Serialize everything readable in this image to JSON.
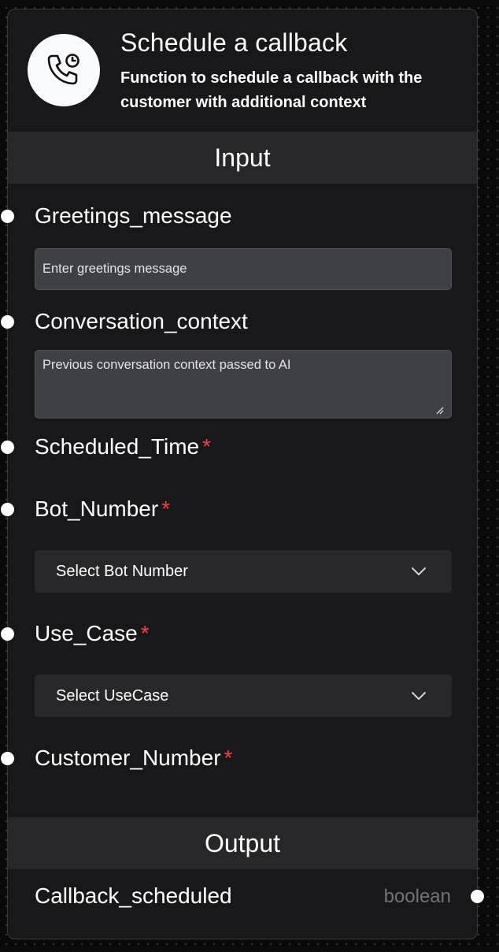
{
  "node": {
    "title": "Schedule a callback",
    "description": "Function to schedule a callback with the customer with additional context",
    "icon": "phone-clock-icon"
  },
  "input_section": {
    "label": "Input",
    "fields": [
      {
        "name": "Greetings_message",
        "required": false,
        "type": "text",
        "placeholder": "Enter greetings message",
        "value": ""
      },
      {
        "name": "Conversation_context",
        "required": false,
        "type": "textarea",
        "placeholder": "Previous conversation context passed to AI",
        "value": ""
      },
      {
        "name": "Scheduled_Time",
        "required": true,
        "type": "handle-only"
      },
      {
        "name": "Bot_Number",
        "required": true,
        "type": "select",
        "selected": "Select Bot Number"
      },
      {
        "name": "Use_Case",
        "required": true,
        "type": "select",
        "selected": "Select UseCase"
      },
      {
        "name": "Customer_Number",
        "required": true,
        "type": "handle-only"
      }
    ],
    "required_mark": "*"
  },
  "output_section": {
    "label": "Output",
    "outputs": [
      {
        "name": "Callback_scheduled",
        "type": "boolean"
      }
    ]
  },
  "colors": {
    "node_background": "#18181b",
    "section_bar": "#27272a",
    "input_background": "#3f3f46",
    "required": "#ef4444",
    "muted_text": "#71717a",
    "handle": "#ffffff"
  }
}
